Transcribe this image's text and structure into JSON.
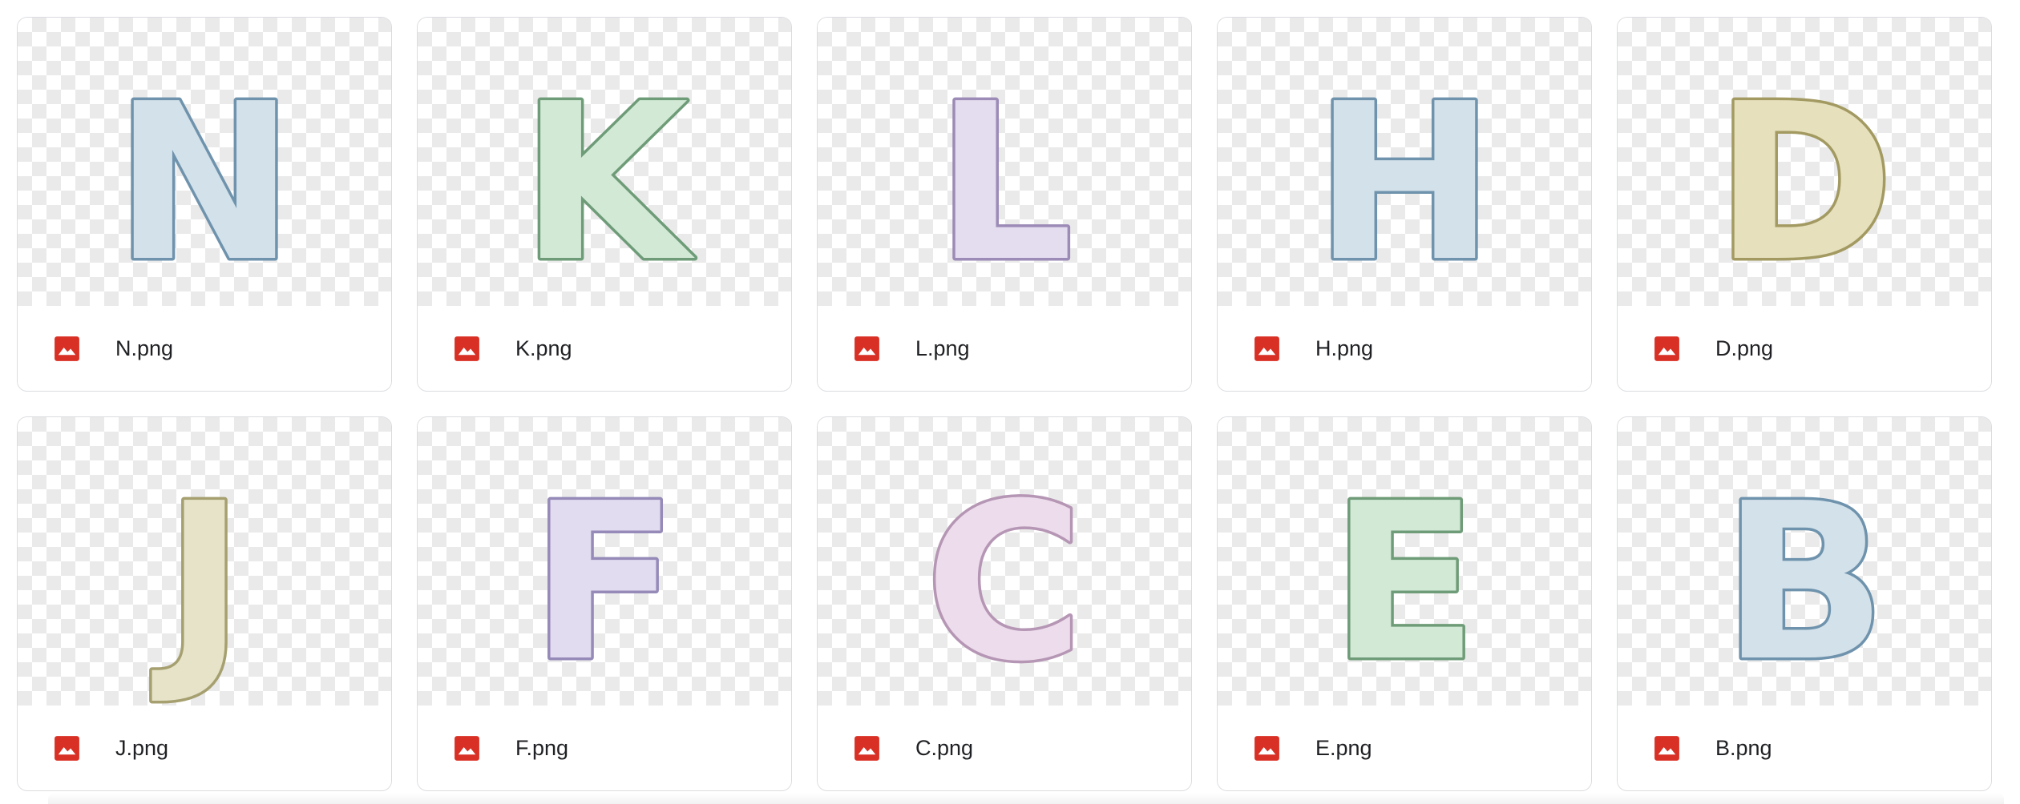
{
  "files": [
    {
      "name": "N.png",
      "letter": "N",
      "fill": "#d3e1ea",
      "stroke": "#6f93ad"
    },
    {
      "name": "K.png",
      "letter": "K",
      "fill": "#d2e9d6",
      "stroke": "#6f9c78"
    },
    {
      "name": "L.png",
      "letter": "L",
      "fill": "#e4dcef",
      "stroke": "#9c8bb6"
    },
    {
      "name": "H.png",
      "letter": "H",
      "fill": "#d3e1ea",
      "stroke": "#6f93ad"
    },
    {
      "name": "D.png",
      "letter": "D",
      "fill": "#e6e0bd",
      "stroke": "#a39a62"
    },
    {
      "name": "J.png",
      "letter": "J",
      "fill": "#e6e3c8",
      "stroke": "#a6a070"
    },
    {
      "name": "F.png",
      "letter": "F",
      "fill": "#e2dcf0",
      "stroke": "#958ab8"
    },
    {
      "name": "C.png",
      "letter": "C",
      "fill": "#eddcec",
      "stroke": "#b596b4"
    },
    {
      "name": "E.png",
      "letter": "E",
      "fill": "#d2e9d6",
      "stroke": "#6f9c78"
    },
    {
      "name": "B.png",
      "letter": "B",
      "fill": "#d3e1ea",
      "stroke": "#6f93ad"
    }
  ],
  "icon": {
    "name": "image-file-icon",
    "color": "#d93025"
  }
}
